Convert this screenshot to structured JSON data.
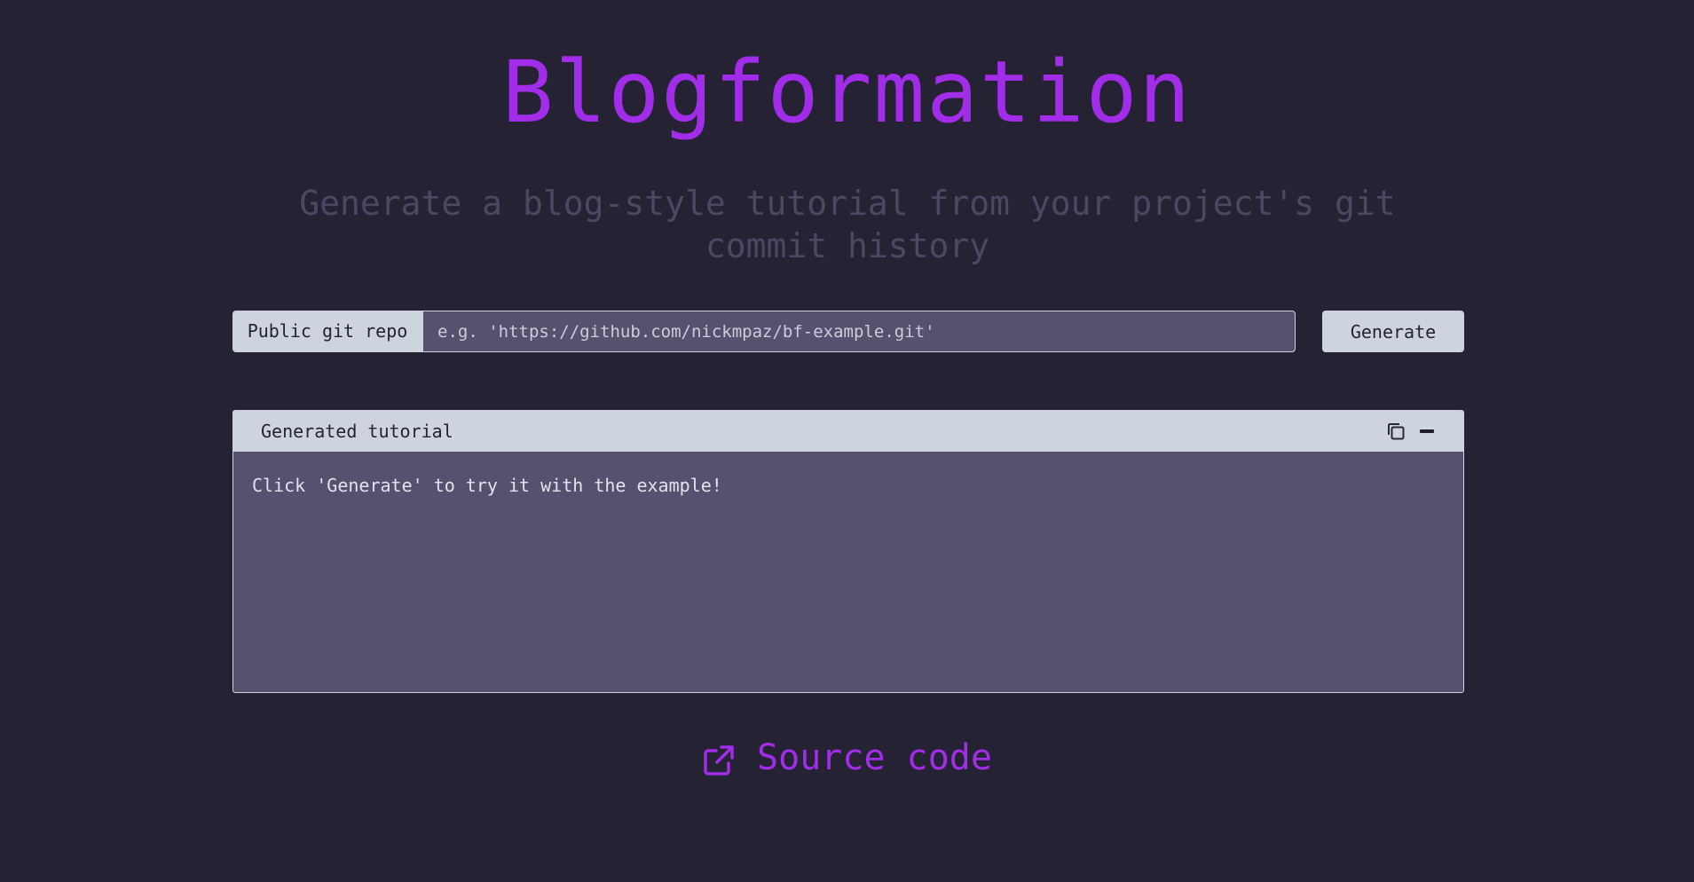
{
  "header": {
    "title": "Blogformation",
    "subtitle": "Generate a blog-style tutorial from your project's git commit history"
  },
  "form": {
    "repo_label": "Public git repo",
    "repo_placeholder": "e.g. 'https://github.com/nickmpaz/bf-example.git'",
    "repo_value": "",
    "generate_label": "Generate"
  },
  "panel": {
    "title": "Generated tutorial",
    "body": "Click 'Generate' to try it with the example!",
    "icons": {
      "copy": "copy-icon",
      "minimize": "minimize-icon"
    }
  },
  "footer": {
    "source_label": "Source code",
    "icon": "external-link-icon"
  },
  "colors": {
    "background": "#252234",
    "accent": "#a12de8",
    "subtitle": "#4c4864",
    "panel_body": "#56516f",
    "light": "#cdd4de"
  }
}
